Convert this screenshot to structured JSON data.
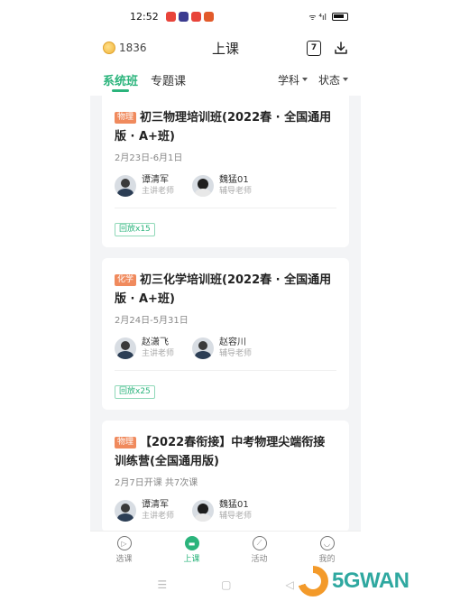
{
  "status_bar": {
    "time": "12:52",
    "notification_colors": [
      "#e8443a",
      "#3b3b8f",
      "#e8443a",
      "#e25a2a"
    ],
    "signal_text": "ᯤ ⁴ıl"
  },
  "header": {
    "coin_count": "1836",
    "title": "上课",
    "calendar_day": "7",
    "download_icon": "download-icon"
  },
  "tabs": {
    "items": [
      {
        "label": "系统班",
        "active": true
      },
      {
        "label": "专题课",
        "active": false
      }
    ],
    "filters": [
      {
        "label": "学科"
      },
      {
        "label": "状态"
      }
    ]
  },
  "courses": [
    {
      "subject": "物理",
      "subject_color": "#f08a5d",
      "title": "初三物理培训班(2022春 · 全国通用版 · A+班)",
      "date": "2月23日-6月1日",
      "teachers": [
        {
          "name": "谭清军",
          "role": "主讲老师"
        },
        {
          "name": "魏猛01",
          "role": "辅导老师"
        }
      ],
      "replay": "回放x15"
    },
    {
      "subject": "化学",
      "subject_color": "#f08a5d",
      "title": "初三化学培训班(2022春 · 全国通用版 · A+班)",
      "date": "2月24日-5月31日",
      "teachers": [
        {
          "name": "赵潇飞",
          "role": "主讲老师"
        },
        {
          "name": "赵容川",
          "role": "辅导老师"
        }
      ],
      "replay": "回放x25"
    },
    {
      "subject": "物理",
      "subject_color": "#f08a5d",
      "title": "【2022春衔接】中考物理尖端衔接训练营(全国通用版)",
      "date": "2月7日开课 共7次课",
      "teachers": [
        {
          "name": "谭清军",
          "role": "主讲老师"
        },
        {
          "name": "魏猛01",
          "role": "辅导老师"
        }
      ]
    }
  ],
  "bottom_nav": [
    {
      "label": "选课",
      "icon": "play-circle-icon",
      "glyph": "▷",
      "active": false
    },
    {
      "label": "上课",
      "icon": "class-icon",
      "glyph": "▬",
      "active": true
    },
    {
      "label": "活动",
      "icon": "compass-icon",
      "glyph": "⟋",
      "active": false
    },
    {
      "label": "我的",
      "icon": "smile-icon",
      "glyph": "◡",
      "active": false
    }
  ],
  "system_nav": {
    "menu": "☰",
    "home": "▢",
    "back": "◁"
  },
  "watermark": {
    "text": "5GWAN"
  },
  "accent_color": "#2bb47c"
}
